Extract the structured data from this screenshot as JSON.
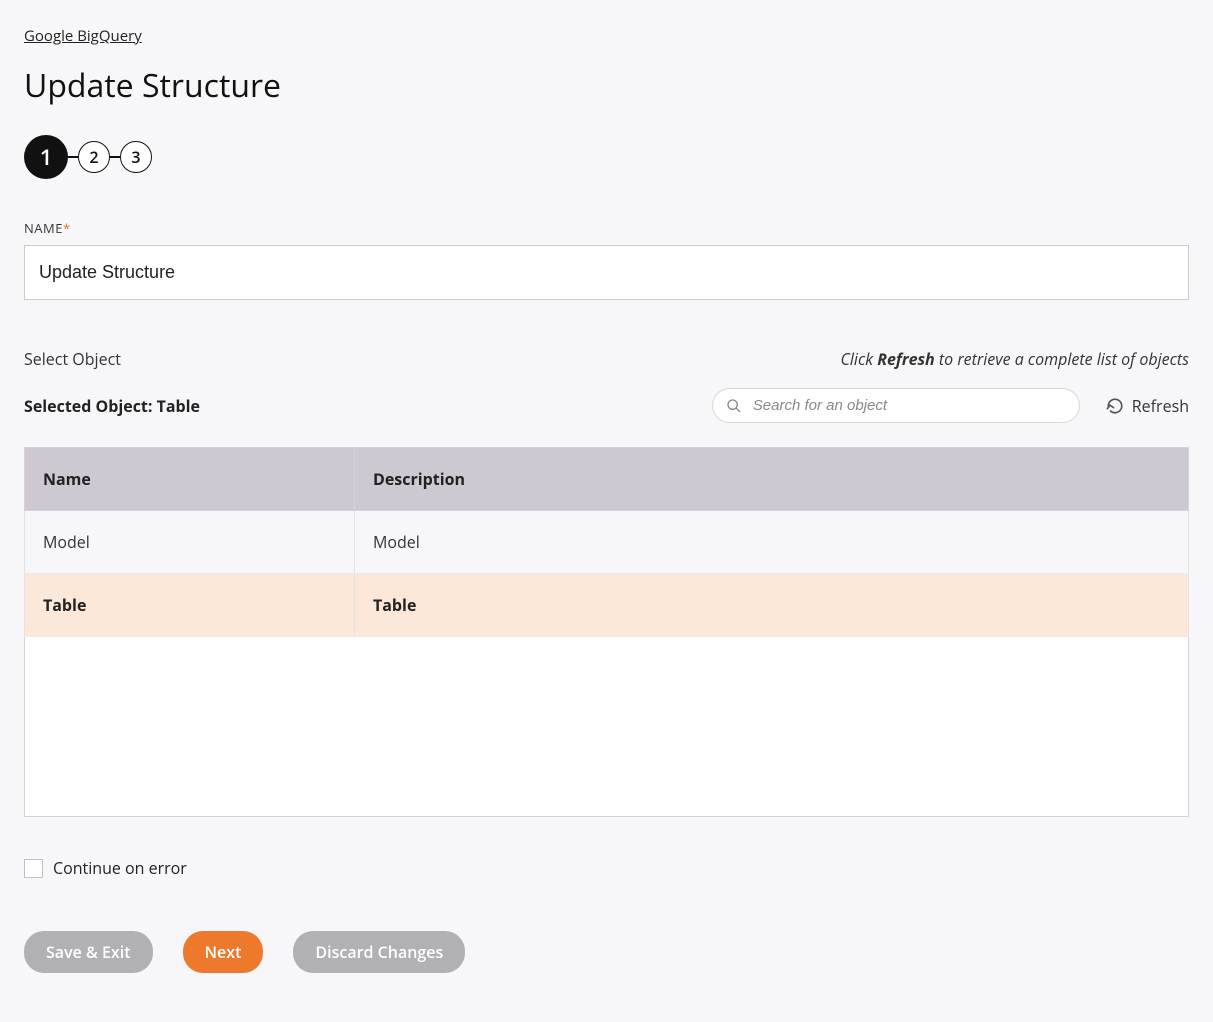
{
  "breadcrumb": "Google BigQuery",
  "page_title": "Update Structure",
  "stepper": {
    "active": "1",
    "s2": "2",
    "s3": "3"
  },
  "name_field": {
    "label": "NAME",
    "value": "Update Structure"
  },
  "select_object": {
    "label": "Select Object",
    "hint_pre": "Click ",
    "hint_bold": "Refresh",
    "hint_post": " to retrieve a complete list of objects",
    "selected_label": "Selected Object: Table",
    "search_placeholder": "Search for an object",
    "refresh_label": "Refresh"
  },
  "table": {
    "headers": {
      "name": "Name",
      "desc": "Description"
    },
    "rows": [
      {
        "name": "Model",
        "desc": "Model",
        "selected": false
      },
      {
        "name": "Table",
        "desc": "Table",
        "selected": true
      }
    ]
  },
  "continue_on_error": {
    "label": "Continue on error",
    "checked": false
  },
  "actions": {
    "save_exit": "Save & Exit",
    "next": "Next",
    "discard": "Discard Changes"
  }
}
